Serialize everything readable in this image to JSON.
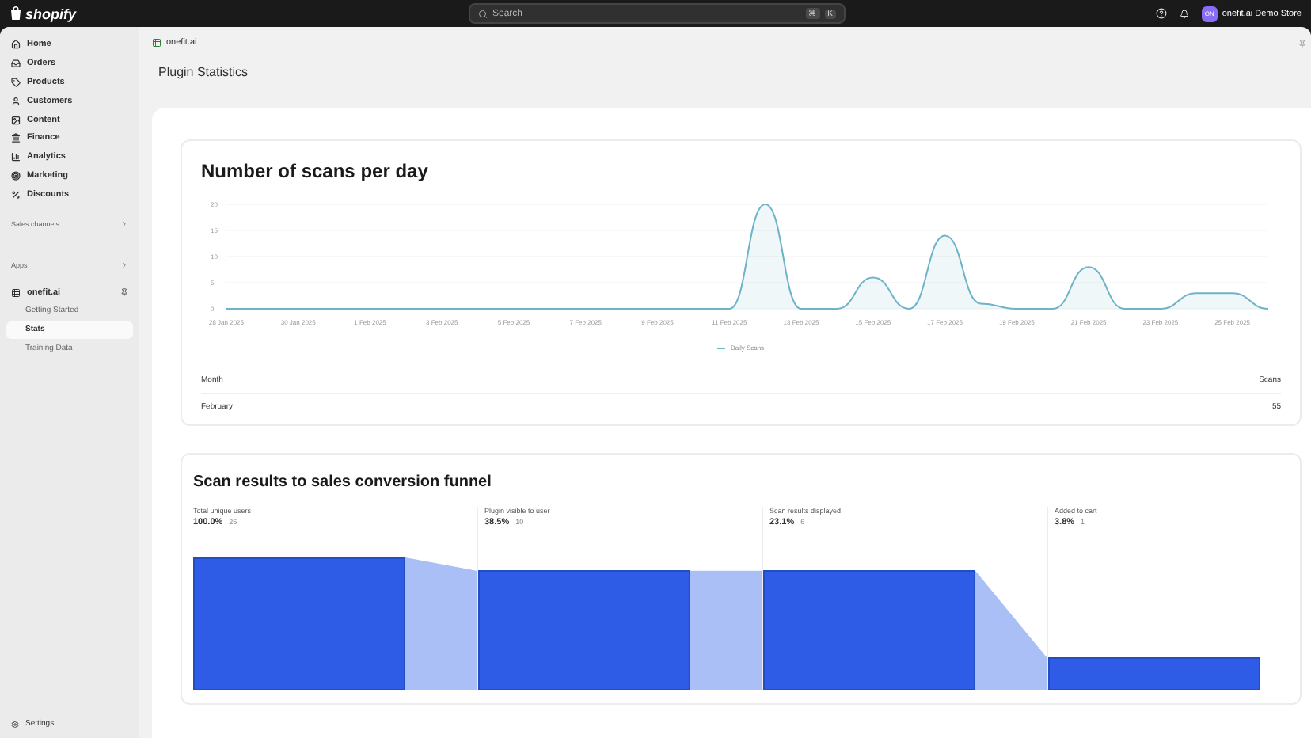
{
  "topbar": {
    "brand": "shopify",
    "search": {
      "placeholder": "Search",
      "keys": [
        "⌘",
        "K"
      ]
    },
    "avatar": "ON",
    "store": "onefit.ai Demo Store"
  },
  "sidebar": {
    "items": [
      {
        "label": "Home",
        "selected": false
      },
      {
        "label": "Orders",
        "selected": false
      },
      {
        "label": "Products",
        "selected": false
      },
      {
        "label": "Customers",
        "selected": false
      },
      {
        "label": "Content",
        "selected": false
      },
      {
        "label": "Finance",
        "selected": false
      },
      {
        "label": "Analytics",
        "selected": false
      },
      {
        "label": "Marketing",
        "selected": false
      },
      {
        "label": "Discounts",
        "selected": false
      }
    ],
    "sections": [
      {
        "label": "Sales channels"
      },
      {
        "label": "Apps"
      }
    ],
    "app": {
      "label": "onefit.ai",
      "children": [
        {
          "label": "Getting Started",
          "selected": false
        },
        {
          "label": "Stats",
          "selected": true
        },
        {
          "label": "Training Data",
          "selected": false
        }
      ]
    },
    "settings": "Settings"
  },
  "breadcrumb": "onefit.ai",
  "page_title": "Plugin Statistics",
  "scans_card": {
    "title": "Number of scans per day",
    "chart_data": {
      "type": "area",
      "categories": [
        "28 Jan 2025",
        null,
        "30 Jan 2025",
        null,
        "1 Feb 2025",
        null,
        "3 Feb 2025",
        null,
        "5 Feb 2025",
        null,
        "7 Feb 2025",
        null,
        "9 Feb 2025",
        null,
        "11 Feb 2025",
        null,
        "13 Feb 2025",
        null,
        "15 Feb 2025",
        null,
        "17 Feb 2025",
        null,
        "19 Feb 2025",
        null,
        "21 Feb 2025",
        null,
        "23 Feb 2025",
        null,
        "25 Feb 2025",
        null
      ],
      "series": [
        {
          "name": "Daily Scans",
          "color": "#6fb3c9",
          "values": [
            0,
            0,
            0,
            0,
            0,
            0,
            0,
            0,
            0,
            0,
            0,
            0,
            0,
            0,
            0,
            20,
            0,
            0,
            6,
            0,
            14,
            1,
            0,
            0,
            8,
            0,
            0,
            3,
            3,
            0
          ]
        }
      ],
      "ylim": [
        0,
        20
      ],
      "yticks": [
        0,
        5,
        10,
        15,
        20
      ],
      "grid": true
    },
    "table": {
      "columns": [
        "Month",
        "Scans"
      ],
      "rows": [
        [
          "February",
          "55"
        ]
      ]
    }
  },
  "funnel_card": {
    "title": "Scan results to sales conversion funnel",
    "steps": [
      {
        "label": "Total unique users",
        "percent": "100.0%",
        "count": "26"
      },
      {
        "label": "Plugin visible to user",
        "percent": "38.5%",
        "count": "10"
      },
      {
        "label": "Scan results displayed",
        "percent": "23.1%",
        "count": "6"
      },
      {
        "label": "Added to cart",
        "percent": "3.8%",
        "count": "1"
      }
    ]
  }
}
